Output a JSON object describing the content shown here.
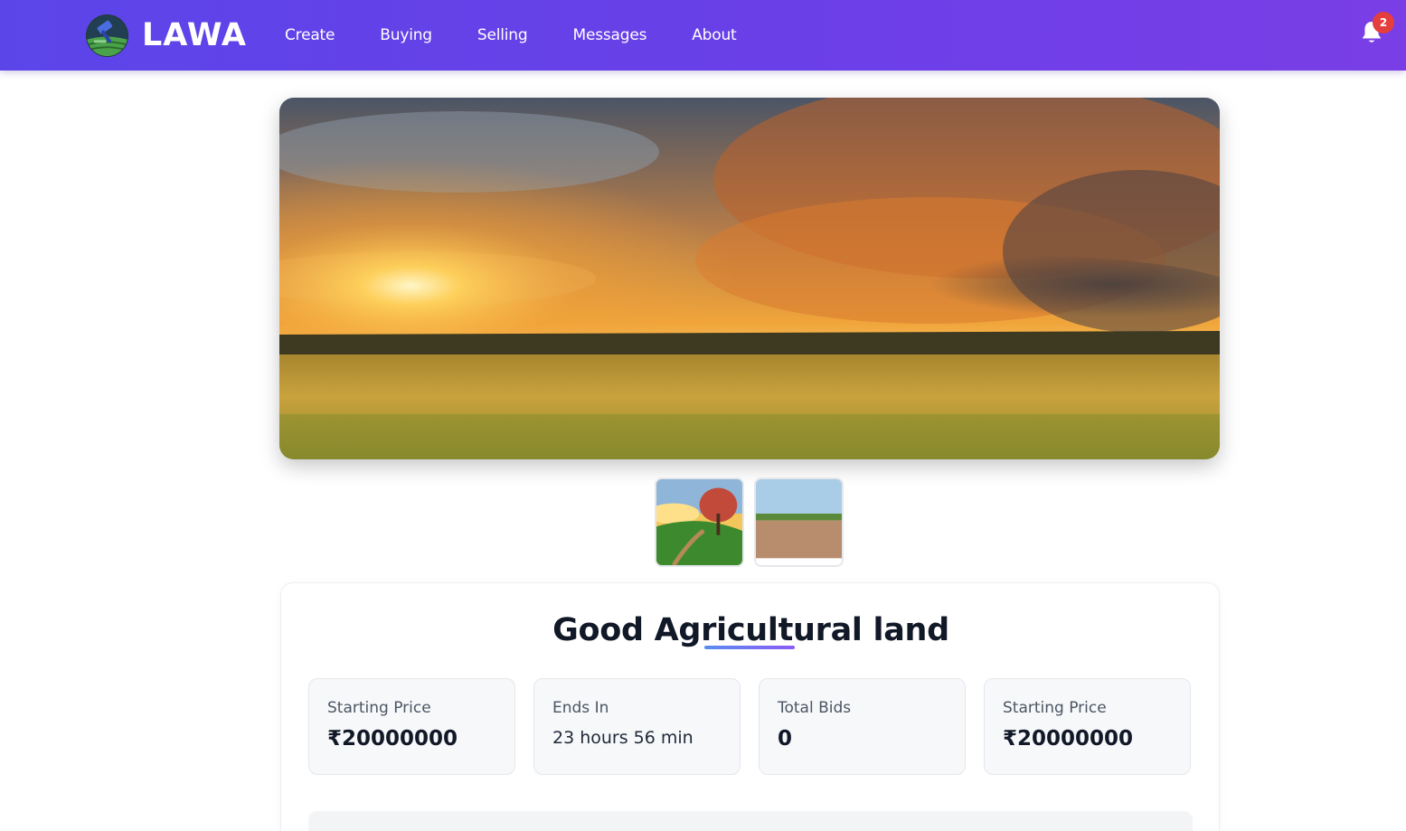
{
  "app": {
    "name": "LAWA",
    "logo_icon": "gavel-field-logo-icon"
  },
  "nav": {
    "items": [
      {
        "label": "Create"
      },
      {
        "label": "Buying"
      },
      {
        "label": "Selling"
      },
      {
        "label": "Messages"
      },
      {
        "label": "About"
      }
    ],
    "notifications": {
      "icon": "bell-icon",
      "count": "2"
    }
  },
  "colors": {
    "nav_gradient_start": "#5b45e9",
    "nav_gradient_end": "#7a3ee6",
    "badge": "#e53e3e",
    "title_underline_start": "#5b8def",
    "title_underline_end": "#8b5cf6"
  },
  "gallery": {
    "main_image": "sunset-over-grass-field-photo",
    "thumbnails": [
      {
        "image": "painted-tree-hillside-thumbnail"
      },
      {
        "image": "dry-plot-land-thumbnail"
      }
    ]
  },
  "listing": {
    "title": "Good Agricultural land",
    "stats": [
      {
        "label": "Starting Price",
        "value": "₹20000000"
      },
      {
        "label": "Ends In",
        "value": "23 hours 56 min"
      },
      {
        "label": "Total Bids",
        "value": "0"
      },
      {
        "label": "Starting Price",
        "value": "₹20000000"
      }
    ]
  }
}
